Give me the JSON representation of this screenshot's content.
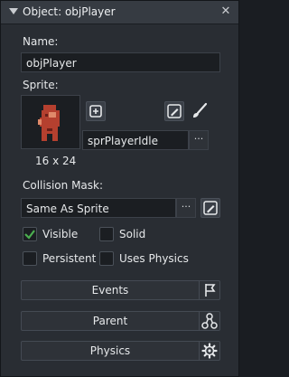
{
  "window": {
    "title": "Object: objPlayer",
    "collapse_icon": "triangle-down-icon",
    "close_icon": "close-icon"
  },
  "name": {
    "label": "Name:",
    "value": "objPlayer"
  },
  "sprite": {
    "label": "Sprite:",
    "name": "sprPlayerIdle",
    "size": "16 x 24",
    "browse_label": "···",
    "new_icon": "new-sprite-icon",
    "edit_icon": "edit-image-icon",
    "paint_icon": "brush-icon"
  },
  "collision": {
    "label": "Collision Mask:",
    "value": "Same As Sprite",
    "browse_label": "···",
    "edit_icon": "edit-image-icon"
  },
  "flags": {
    "visible": {
      "label": "Visible",
      "checked": true
    },
    "solid": {
      "label": "Solid",
      "checked": false
    },
    "persistent": {
      "label": "Persistent",
      "checked": false
    },
    "uses_physics": {
      "label": "Uses Physics",
      "checked": false
    }
  },
  "buttons": {
    "events": {
      "label": "Events",
      "icon": "flag-icon"
    },
    "parent": {
      "label": "Parent",
      "icon": "hierarchy-icon"
    },
    "physics": {
      "label": "Physics",
      "icon": "gear-icon"
    }
  },
  "colors": {
    "accent_check": "#4caf50",
    "sprite_body": "#c0392b"
  }
}
